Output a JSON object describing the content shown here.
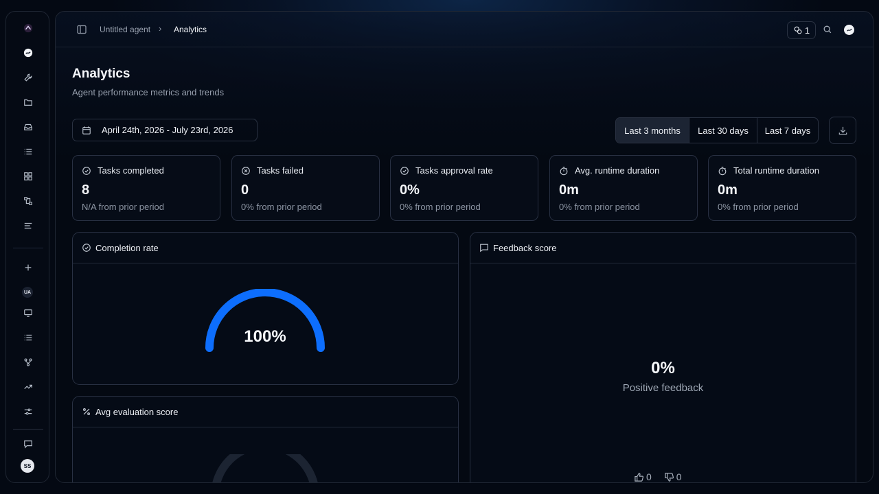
{
  "breadcrumb": {
    "parent": "Untitled agent",
    "separator": "›",
    "current": "Analytics"
  },
  "topbar": {
    "counter": "1"
  },
  "page": {
    "title": "Analytics",
    "subtitle": "Agent performance metrics and trends"
  },
  "filters": {
    "date_range": "April 24th, 2026 - July 23rd, 2026",
    "ranges": [
      {
        "label": "Last 3 months",
        "active": true
      },
      {
        "label": "Last 30 days",
        "active": false
      },
      {
        "label": "Last 7 days",
        "active": false
      }
    ]
  },
  "stats": [
    {
      "label": "Tasks completed",
      "value": "8",
      "delta": "N/A from prior period",
      "icon": "check-circle-icon"
    },
    {
      "label": "Tasks failed",
      "value": "0",
      "delta": "0% from prior period",
      "icon": "x-circle-icon"
    },
    {
      "label": "Tasks approval rate",
      "value": "0%",
      "delta": "0% from prior period",
      "icon": "check-circle-icon"
    },
    {
      "label": "Avg. runtime duration",
      "value": "0m",
      "delta": "0% from prior period",
      "icon": "stopwatch-icon"
    },
    {
      "label": "Total runtime duration",
      "value": "0m",
      "delta": "0% from prior period",
      "icon": "stopwatch-icon"
    }
  ],
  "completion": {
    "title": "Completion rate",
    "value": "100%",
    "fraction": 1.0
  },
  "evaluation": {
    "title": "Avg evaluation score"
  },
  "feedback": {
    "title": "Feedback score",
    "value": "0%",
    "label": "Positive feedback",
    "thumbs_up": "0",
    "thumbs_down": "0"
  },
  "sidebar": {
    "user_initials_agent": "UA",
    "user_initials": "SS"
  },
  "colors": {
    "accent": "#0d6efd",
    "track": "#1c2432"
  }
}
